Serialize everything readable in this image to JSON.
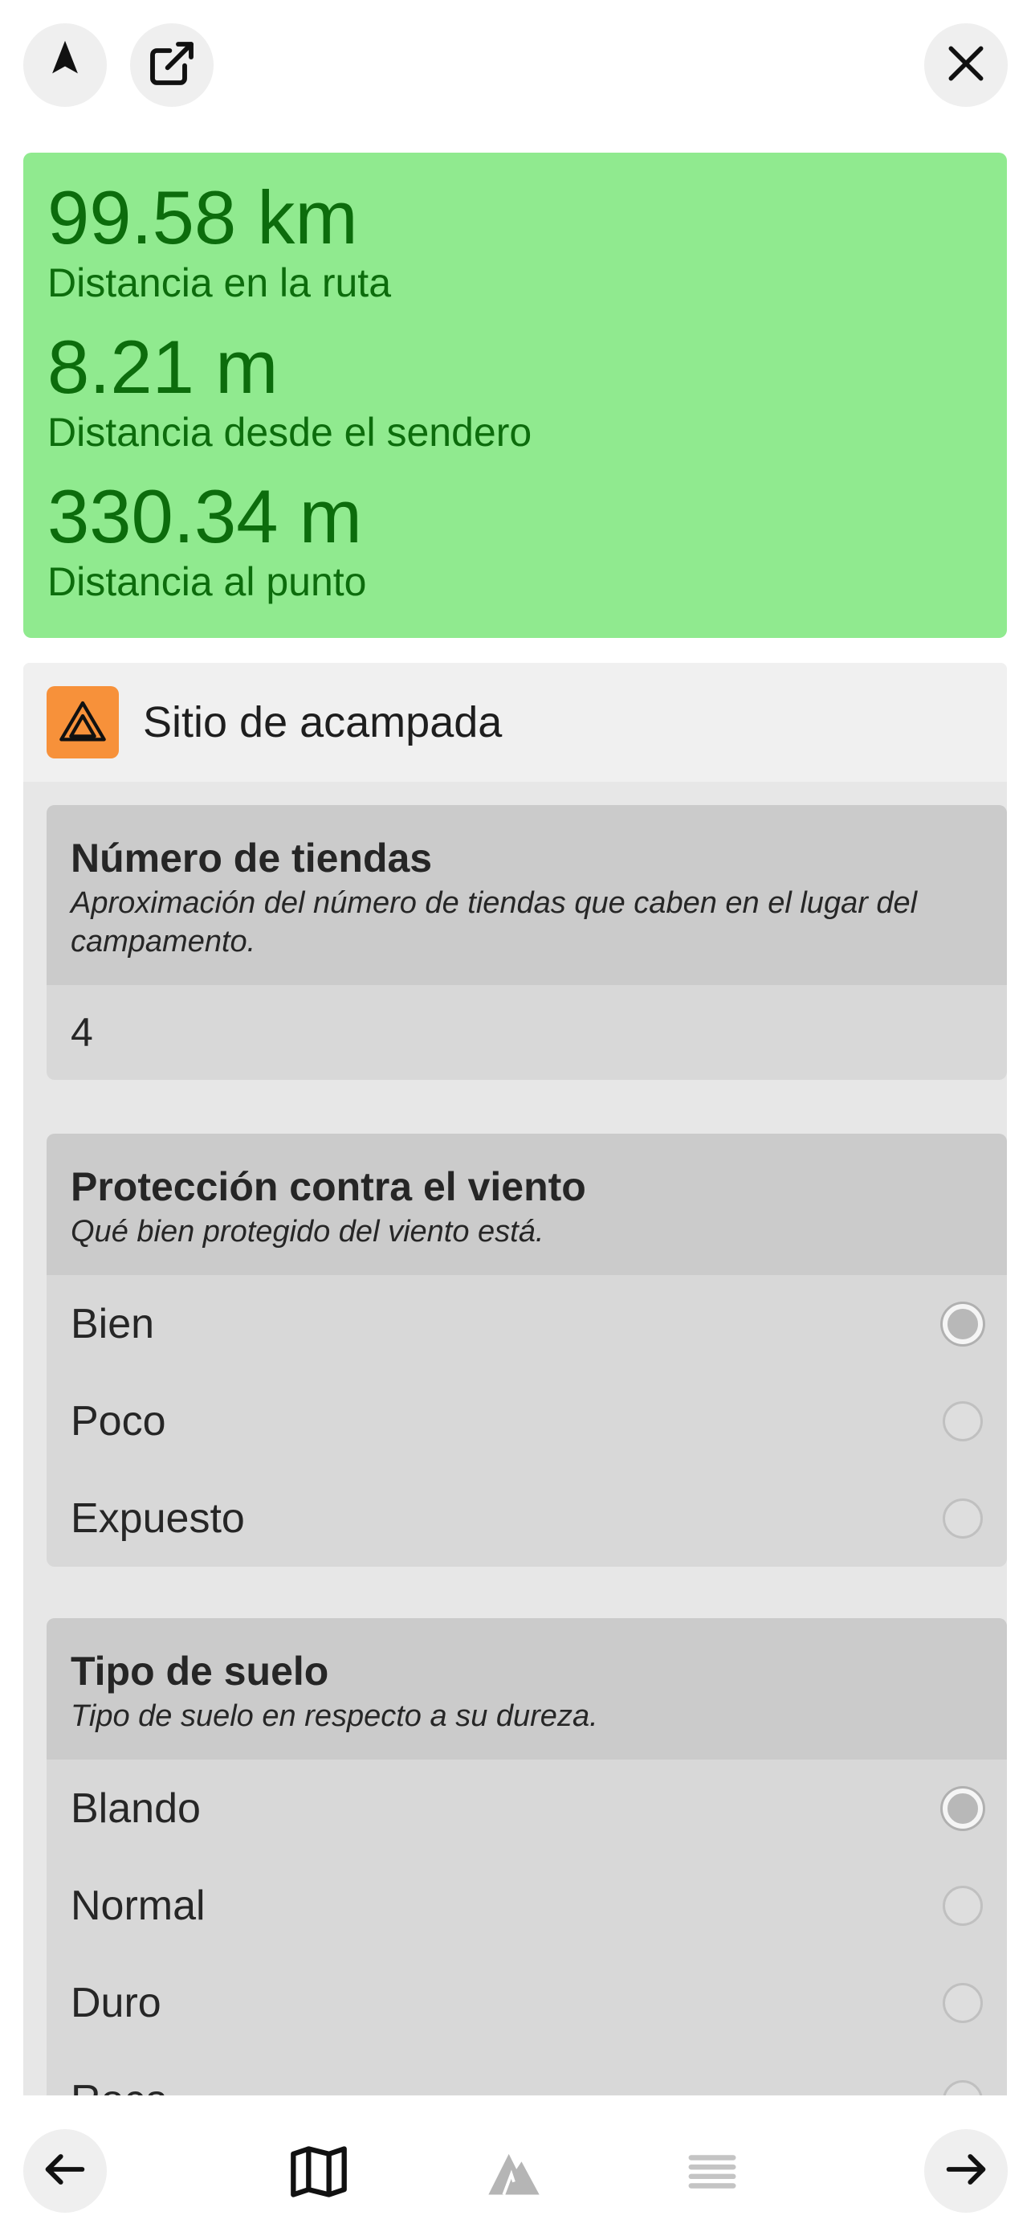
{
  "toolbar": {
    "compass_icon": "compass-icon",
    "external_icon": "external-link-icon",
    "close_icon": "close-icon"
  },
  "stats": [
    {
      "value": "99.58 km",
      "label": "Distancia en la ruta"
    },
    {
      "value": "8.21 m",
      "label": "Distancia desde el sendero"
    },
    {
      "value": "330.34 m",
      "label": "Distancia al punto"
    }
  ],
  "feature": {
    "title": "Sitio de acampada",
    "icon": "tent-icon",
    "icon_color": "#f7913a"
  },
  "fields": {
    "tents": {
      "title": "Número de tiendas",
      "description": "Aproximación del número de tiendas que caben en el lugar del campamento.",
      "value": "4"
    },
    "wind": {
      "title": "Protección contra el viento",
      "description": "Qué bien protegido del viento está.",
      "options": [
        "Bien",
        "Poco",
        "Expuesto"
      ],
      "selected": "Bien"
    },
    "ground": {
      "title": "Tipo de suelo",
      "description": "Tipo de suelo en respecto a su dureza.",
      "options": [
        "Blando",
        "Normal",
        "Duro",
        "Roca"
      ],
      "selected": "Blando"
    }
  },
  "bottom_nav": {
    "back_icon": "arrow-left-icon",
    "map_icon": "map-icon",
    "mountain_icon": "mountain-icon",
    "list_icon": "list-icon",
    "next_icon": "arrow-right-icon"
  },
  "colors": {
    "stats_bg": "#90ea8f",
    "stats_text": "#0c6c0c",
    "accent": "#f7913a"
  }
}
